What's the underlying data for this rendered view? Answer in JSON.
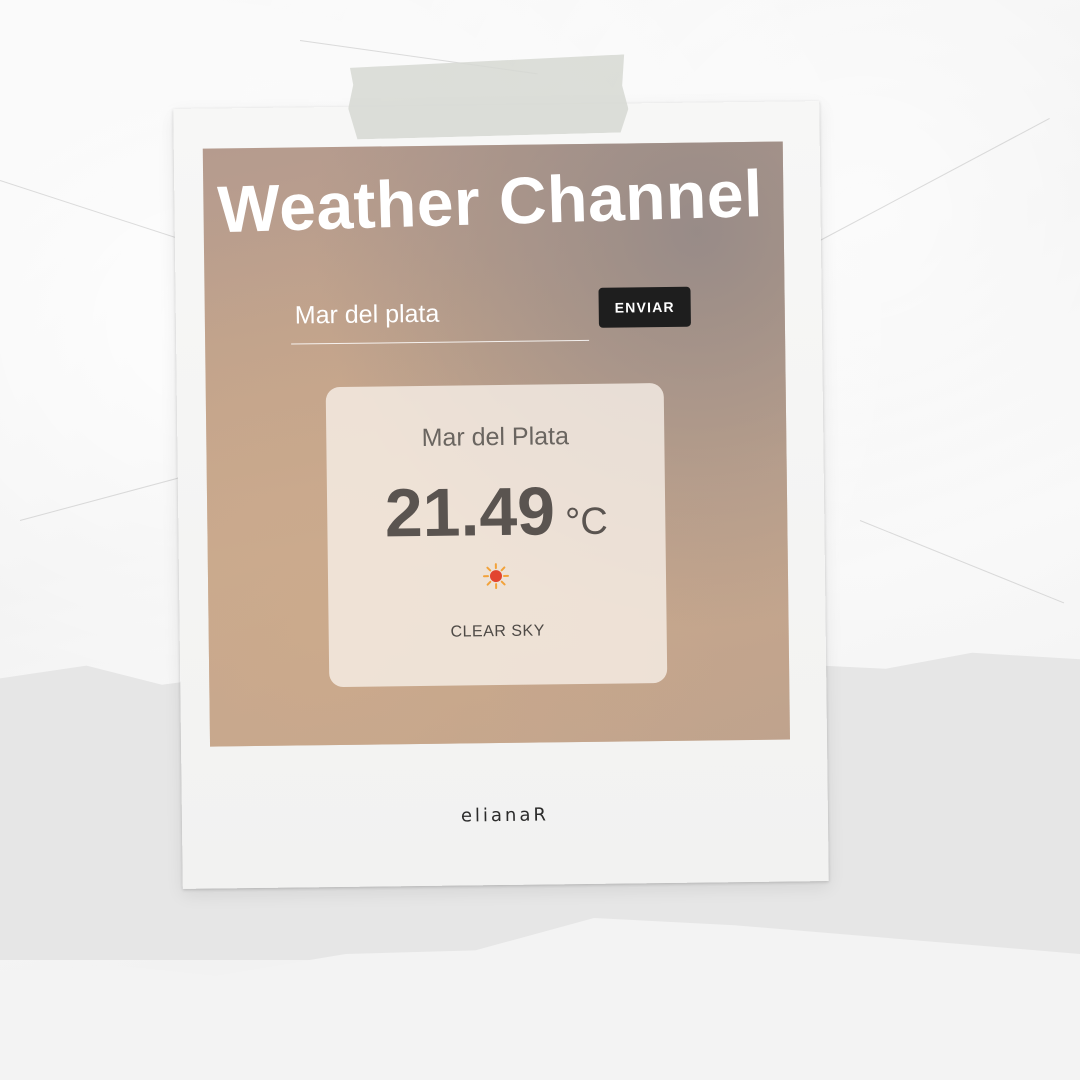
{
  "app": {
    "title": "Weather Channel"
  },
  "search": {
    "value": "Mar del plata",
    "placeholder": "Mar del plata",
    "button_label": "ENVIAR"
  },
  "weather": {
    "city": "Mar del Plata",
    "temperature": "21.49",
    "unit": "°C",
    "icon": "sun-icon",
    "condition": "CLEAR SKY"
  },
  "caption": "elianaR",
  "colors": {
    "button": "#1e1e1e",
    "title": "#ffffff",
    "card": "#f8f0e9",
    "sun": "#e2452f"
  }
}
